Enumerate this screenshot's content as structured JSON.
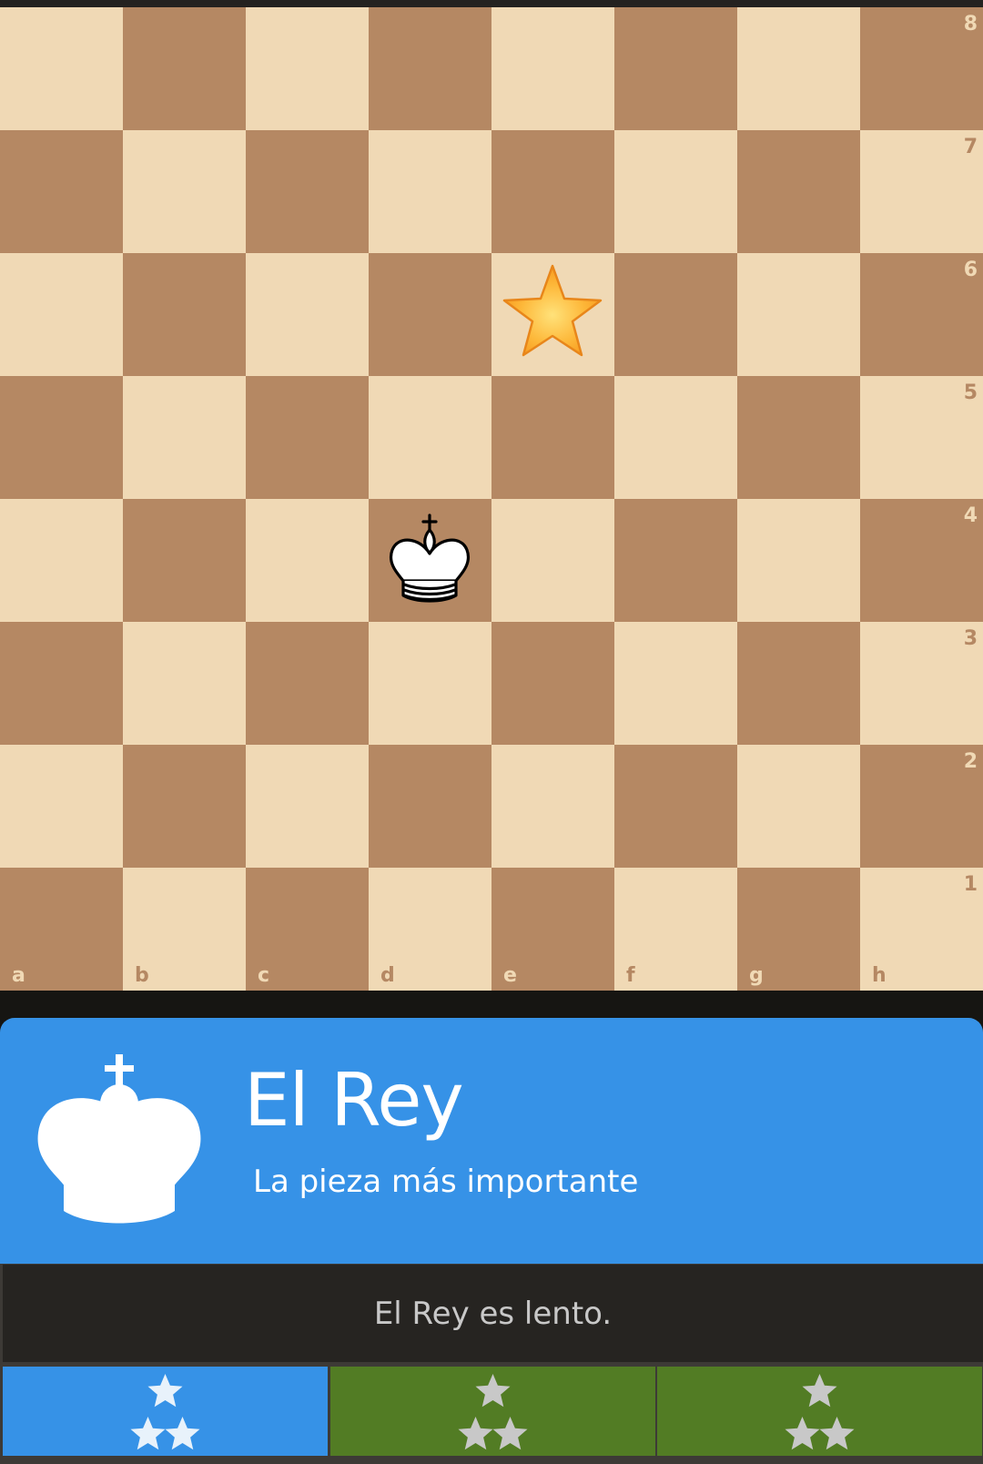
{
  "board": {
    "ranks": [
      "8",
      "7",
      "6",
      "5",
      "4",
      "3",
      "2",
      "1"
    ],
    "files": [
      "a",
      "b",
      "c",
      "d",
      "e",
      "f",
      "g",
      "h"
    ],
    "pieces": [
      {
        "piece": "white-king",
        "square": "d4"
      }
    ],
    "target": {
      "icon": "star-icon",
      "square": "e6"
    }
  },
  "lesson": {
    "icon": "king-icon",
    "title": "El Rey",
    "subtitle": "La pieza más importante",
    "message": "El Rey es lento."
  },
  "levels": [
    {
      "stars": 3,
      "state": "current"
    },
    {
      "stars": 3,
      "state": "pending"
    },
    {
      "stars": 3,
      "state": "pending"
    }
  ],
  "colors": {
    "light_square": "#f0d9b5",
    "dark_square": "#b58863",
    "accent_blue": "#3692e7",
    "level_green": "#527c24"
  }
}
